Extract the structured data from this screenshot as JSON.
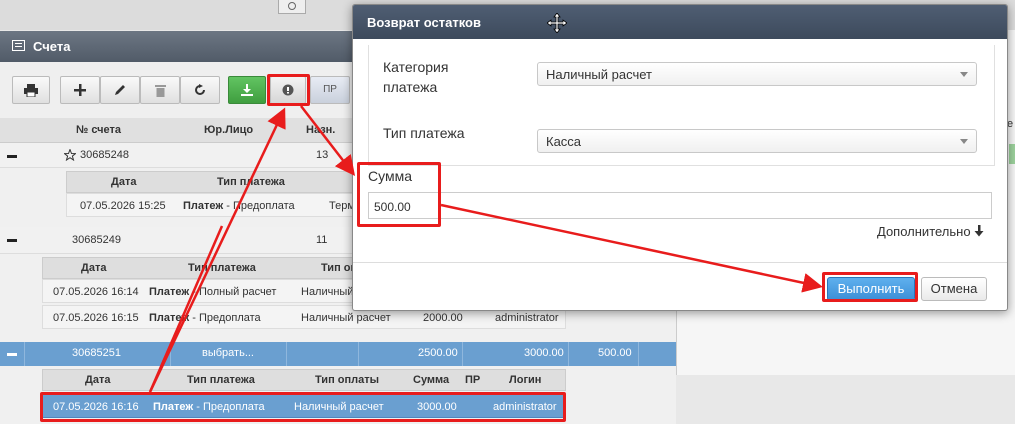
{
  "panel": {
    "title": "Счета"
  },
  "toolbar": {
    "pr_label": "ПР"
  },
  "grid": {
    "headers": {
      "account": "№ счета",
      "entity": "Юр.Лицо",
      "purpose": "Назн."
    },
    "rows": [
      {
        "account": "30685248",
        "purpose": "13"
      },
      {
        "account": "30685249",
        "purpose": "11"
      }
    ],
    "selected": {
      "account": "30685251",
      "entity": "выбрать...",
      "v1": "2500.00",
      "v2": "3000.00",
      "v3": "500.00"
    }
  },
  "sub1": {
    "headers": {
      "date": "Дата",
      "type": "Тип платежа"
    },
    "row": {
      "date": "07.05.2026 15:25",
      "type_bold": "Платеж",
      "type_rest": " - Предоплата",
      "cut": "Терм"
    }
  },
  "sub2": {
    "headers": {
      "date": "Дата",
      "type": "Тип платежа",
      "pay": "Тип опл"
    },
    "rows": [
      {
        "date": "07.05.2026 16:14",
        "type_bold": "Платеж",
        "type_rest": " - Полный расчет",
        "pay": "Наличный расчет",
        "sum": "",
        "login": ""
      },
      {
        "date": "07.05.2026 16:15",
        "type_bold": "Платеж",
        "type_rest": " - Предоплата",
        "pay": "Наличный расчет",
        "sum": "2000.00",
        "login": "administrator"
      }
    ]
  },
  "sub3": {
    "headers": {
      "date": "Дата",
      "type": "Тип платежа",
      "pay": "Тип оплаты",
      "sum": "Сумма",
      "pr": "ПР",
      "login": "Логин"
    },
    "row": {
      "date": "07.05.2026 16:16",
      "type_bold": "Платеж",
      "type_rest": " - Предоплата",
      "pay": "Наличный расчет",
      "sum": "3000.00",
      "login": "administrator"
    }
  },
  "modal": {
    "title": "Возврат остатков",
    "category_label": "Категория платежа",
    "category_value": "Наличный расчет",
    "type_label": "Тип платежа",
    "type_value": "Касса",
    "sum_label": "Сумма",
    "sum_value": "500.00",
    "more_label": "Дополнительно",
    "ok_label": "Выполнить",
    "cancel_label": "Отмена"
  },
  "right_peek": {
    "text": "е"
  },
  "colors": {
    "highlight": "#e81c1c",
    "selected_row": "#6a9fd0",
    "ok_button": "#3c8fd6"
  }
}
